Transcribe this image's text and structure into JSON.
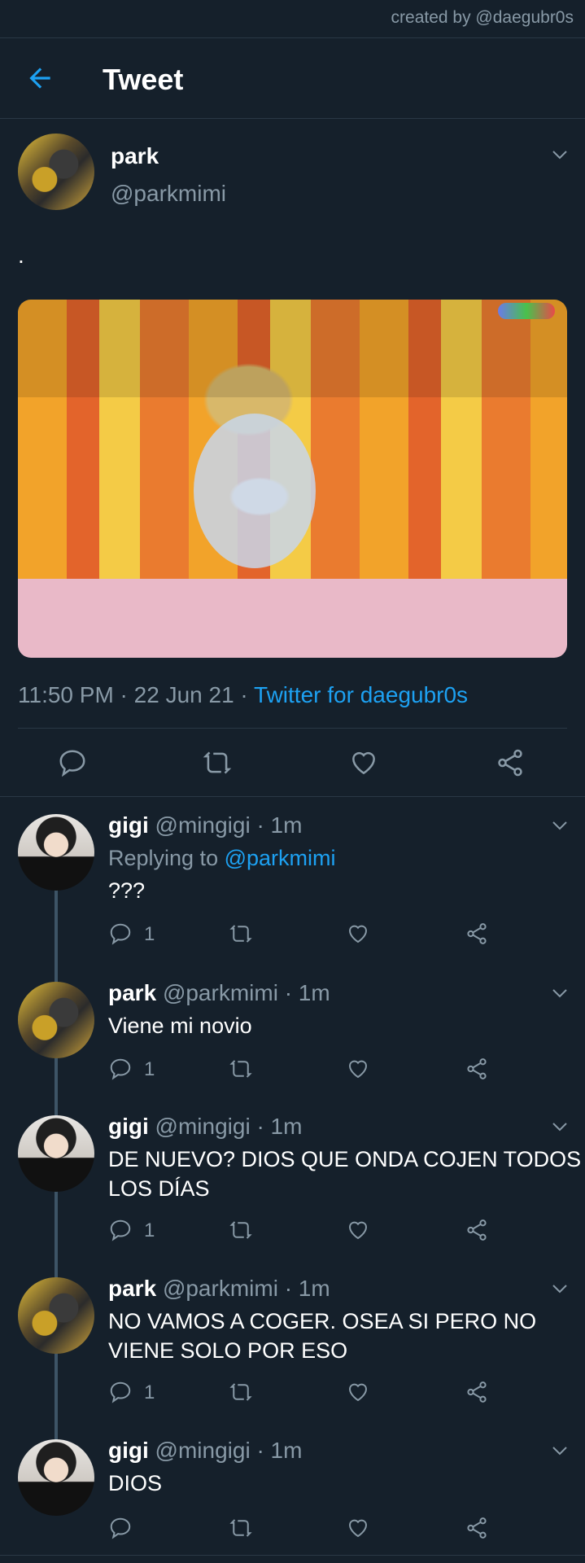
{
  "credit": "created by @daegubr0s",
  "header": {
    "title": "Tweet"
  },
  "tweet": {
    "name": "park",
    "handle": "@parkmimi",
    "text": ".",
    "time": "11:50 PM · 22 Jun 21 · ",
    "source": "Twitter for daegubr0s"
  },
  "replies": [
    {
      "name": "gigi",
      "handle": "@mingigi · 1m",
      "replying_prefix": "Replying to ",
      "replying_to": "@parkmimi",
      "text": "???",
      "reply_count": "1"
    },
    {
      "name": "park",
      "handle": "@parkmimi · 1m",
      "text": "Viene mi novio",
      "reply_count": "1"
    },
    {
      "name": "gigi",
      "handle": "@mingigi · 1m",
      "text_line1": "DE NUEVO? DIOS QUE ONDA COJEN TODOS",
      "text_line2": "LOS DÍAS",
      "reply_count": "1"
    },
    {
      "name": "park",
      "handle": "@parkmimi · 1m",
      "text_line1": "NO VAMOS A COGER. OSEA SI PERO NO",
      "text_line2": "VIENE SOLO POR ESO",
      "reply_count": "1"
    },
    {
      "name": "gigi",
      "handle": "@mingigi · 1m",
      "text": "DIOS",
      "reply_count": ""
    }
  ],
  "colors": {
    "background": "#15202b",
    "accent": "#1da1f2",
    "muted": "#8899a6",
    "divider": "#2a3845"
  },
  "icons": [
    "back-arrow-icon",
    "chevron-down-icon",
    "reply-icon",
    "retweet-icon",
    "like-icon",
    "share-icon"
  ]
}
